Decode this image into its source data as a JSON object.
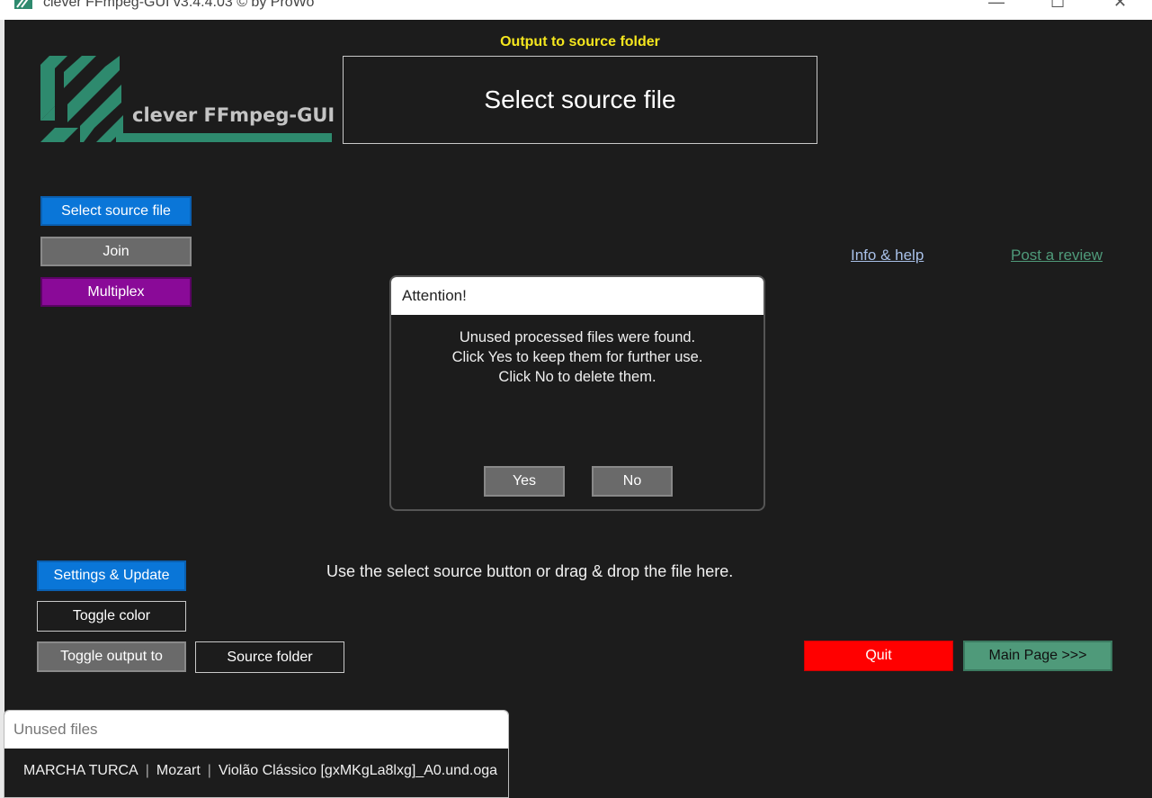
{
  "window": {
    "title": "clever FFmpeg-GUI v3.4.4.03   © by ProWo",
    "controls": [
      "minimize",
      "maximize",
      "close"
    ]
  },
  "header": {
    "output_notice": "Output to source folder",
    "drop_box_label": "Select source file",
    "logo_text": "clever FFmpeg-GUI"
  },
  "left_buttons": {
    "select_source": "Select source file",
    "join": "Join",
    "multiplex": "Multiplex"
  },
  "links": {
    "info_help": "Info & help",
    "post_review": "Post a review"
  },
  "dialog": {
    "title": "Attention!",
    "message_lines": [
      "Unused processed files were found.",
      "Click Yes to keep them for further use.",
      "Click No to delete them."
    ],
    "yes": "Yes",
    "no": "No"
  },
  "hint": "Use the select source button or drag & drop the file here.",
  "bottom_buttons": {
    "settings": "Settings & Update",
    "toggle_color": "Toggle color",
    "toggle_output": "Toggle output to",
    "output_target": "Source folder",
    "quit": "Quit",
    "main_page": "Main Page >>>"
  },
  "unused_panel": {
    "title": "Unused files",
    "file_parts": [
      "MARCHA TURCA",
      "Mozart",
      "Violão Clássico [gxMKgLa8lxg]_A0.und.oga"
    ]
  },
  "colors": {
    "background": "#1c1c1c",
    "accent_blue": "#0a76d8",
    "purple": "#8a0a98",
    "green": "#4f9a7a",
    "red": "#ff0000",
    "notice_yellow": "#f5e61e",
    "logo_green": "#2e8a6e"
  }
}
